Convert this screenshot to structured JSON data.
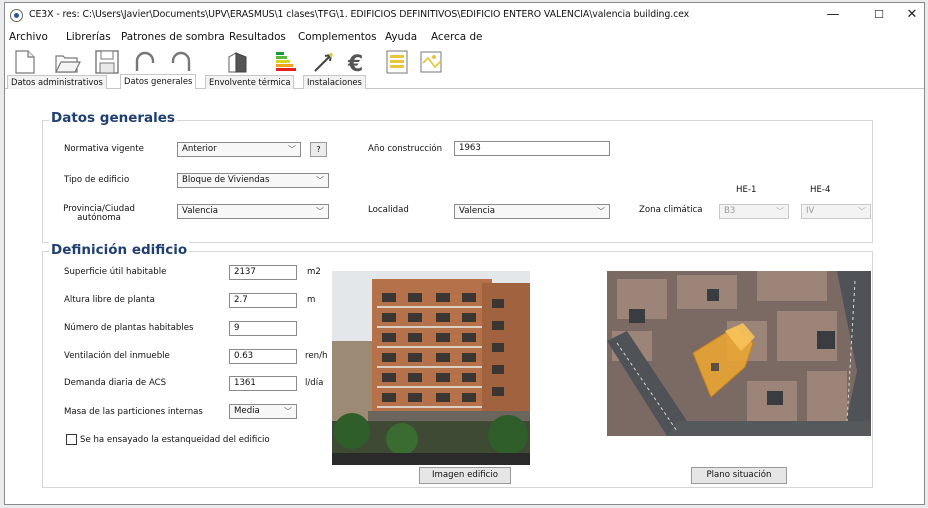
{
  "window": {
    "title": "CE3X - res: C:\\Users\\Javier\\Documents\\UPV\\ERASMUS\\1 clases\\TFG\\1. EDIFICIOS DEFINITIVOS\\EDIFICIO ENTERO VALENCIA\\valencia building.cex",
    "minimize": "—",
    "maximize": "☐",
    "close": "✕"
  },
  "menu": [
    "Archivo",
    "Librerías",
    "Patrones de sombra",
    "Resultados",
    "Complementos",
    "Ayuda",
    "Acerca de"
  ],
  "toolbar": {
    "icons": [
      "new-file-icon",
      "open-folder-icon",
      "save-icon",
      "undo-icon",
      "redo-icon",
      "building-icon",
      "energy-rating-icon",
      "improvement-measures-icon",
      "euro-icon",
      "report-icon",
      "image-icon"
    ],
    "euro_symbol": "€"
  },
  "tabs": [
    {
      "label": "Datos administrativos",
      "active": false
    },
    {
      "label": "Datos generales",
      "active": true
    },
    {
      "label": "Envolvente térmica",
      "active": false
    },
    {
      "label": "Instalaciones",
      "active": false
    }
  ],
  "general": {
    "title": "Datos generales",
    "normativa_label": "Normativa vigente",
    "normativa_value": "Anterior",
    "help_label": "?",
    "anio_label": "Año construcción",
    "anio_value": "1963",
    "tipo_label": "Tipo de edificio",
    "tipo_value": "Bloque de Viviendas",
    "provincia_label_1": "Provincia/Ciudad",
    "provincia_label_2": "autónoma",
    "provincia_value": "Valencia",
    "localidad_label": "Localidad",
    "localidad_value": "Valencia",
    "zona_label": "Zona climática",
    "he1_label": "HE-1",
    "he4_label": "HE-4",
    "he1_value": "B3",
    "he4_value": "IV"
  },
  "definition": {
    "title": "Definición edificio",
    "superficie_label": "Superficie útil habitable",
    "superficie_value": "2137",
    "superficie_unit": "m2",
    "altura_label": "Altura libre de planta",
    "altura_value": "2.7",
    "altura_unit": "m",
    "plantas_label": "Número de plantas habitables",
    "plantas_value": "9",
    "ventilacion_label": "Ventilación del inmueble",
    "ventilacion_value": "0.63",
    "ventilacion_unit": "ren/h",
    "acs_label": "Demanda diaria de ACS",
    "acs_value": "1361",
    "acs_unit": "l/día",
    "masa_label": "Masa de las particiones internas",
    "masa_value": "Media",
    "estanqueidad_label": "Se ha ensayado la estanqueidad del edificio",
    "estanqueidad_checked": false,
    "imagen_button": "Imagen edificio",
    "plano_button": "Plano situación"
  },
  "colors": {
    "title_blue": "#1f3f73",
    "map_highlight": "#f0a830"
  }
}
